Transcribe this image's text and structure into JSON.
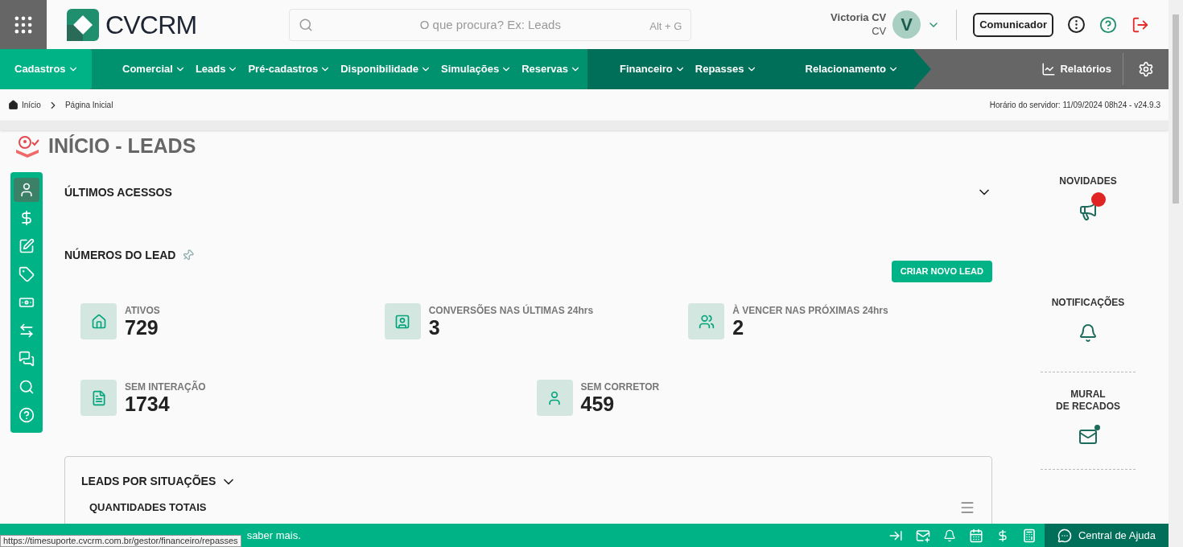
{
  "header": {
    "brand": "CVCRM",
    "search": {
      "placeholder": "O que procura? Ex: Leads",
      "shortcut": "Alt + G"
    },
    "user": {
      "name": "Victoria CV",
      "role": "CV",
      "initial": "V"
    },
    "communicator": "Comunicador"
  },
  "nav": {
    "segments": [
      {
        "kind": "light",
        "items": [
          "Cadastros"
        ]
      },
      {
        "kind": "mid",
        "items": [
          "Comercial",
          "Leads",
          "Pré-cadastros",
          "Disponibilidade",
          "Simulações",
          "Reservas"
        ]
      },
      {
        "kind": "dark",
        "items": [
          "Financeiro",
          "Repasses",
          "Relacionamento"
        ]
      }
    ],
    "reports": "Relatórios"
  },
  "breadcrumb": {
    "items": [
      "Início",
      "Página Inicial"
    ],
    "server_time": "Horário do servidor: 11/09/2024 08h24 - v24.9.3"
  },
  "page_title": "INÍCIO - LEADS",
  "side_toolbar": [
    {
      "selected": true
    },
    {
      "selected": false
    },
    {
      "selected": false
    },
    {
      "selected": false
    },
    {
      "selected": false
    },
    {
      "selected": false
    },
    {
      "selected": false
    },
    {
      "selected": false
    },
    {
      "selected": false
    }
  ],
  "recent_access": {
    "title": "ÚLTIMOS ACESSOS",
    "expanded": false
  },
  "lead_numbers": {
    "title": "NÚMEROS DO LEAD",
    "button": "CRIAR NOVO LEAD",
    "rows": [
      [
        {
          "label": "ATIVOS",
          "value": "729"
        },
        {
          "label": "CONVERSÕES NAS ÚLTIMAS 24hrs",
          "value": "3"
        },
        {
          "label": "À VENCER NAS PRÓXIMAS 24hrs",
          "value": "2"
        }
      ],
      [
        {
          "label": "SEM INTERAÇÃO",
          "value": "1734"
        },
        {
          "label": "SEM CORRETOR",
          "value": "459"
        }
      ]
    ]
  },
  "leads_by_status": {
    "title": "LEADS POR SITUAÇÕES",
    "subtitle": "QUANTIDADES TOTAIS"
  },
  "right_panel": [
    {
      "title": "NOVIDADES",
      "unread": true
    },
    {
      "title": "NOTIFICAÇÕES",
      "unread": false
    },
    {
      "title": "MURAL\nDE RECADOS",
      "unread": true
    }
  ],
  "footer": {
    "message": "saber mais.",
    "url": "https://timesuporte.cvcrm.com.br/gestor/financeiro/repasses",
    "help": "Central de Ajuda"
  }
}
